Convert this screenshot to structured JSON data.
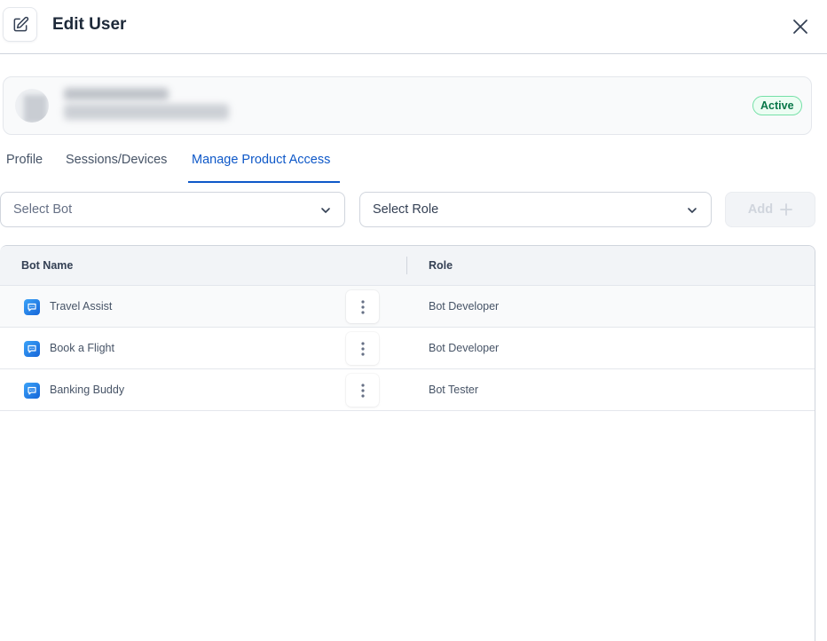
{
  "header": {
    "title": "Edit User",
    "edit_icon": "edit-pencil-icon",
    "close_icon": "close-icon"
  },
  "user": {
    "status": "Active"
  },
  "tabs": [
    {
      "label": "Profile"
    },
    {
      "label": "Sessions/Devices"
    },
    {
      "label": "Manage Product Access",
      "active": true
    }
  ],
  "controls": {
    "bot_select_placeholder": "Select Bot",
    "role_select_placeholder": "Select Role",
    "add_label": "Add",
    "add_icon": "plus-icon",
    "chevron_icon": "chevron-down-icon"
  },
  "table": {
    "columns": [
      "Bot Name",
      "Role"
    ],
    "rows": [
      {
        "bot": "Travel Assist",
        "role": "Bot Developer"
      },
      {
        "bot": "Book a Flight",
        "role": "Bot Developer"
      },
      {
        "bot": "Banking Buddy",
        "role": "Bot Tester"
      }
    ],
    "row_icon": "chat-bot-icon",
    "row_menu_icon": "more-vertical-icon"
  },
  "colors": {
    "accent": "#0e58c8",
    "active_badge_text": "#067647",
    "active_badge_bg": "#ecfdf3"
  }
}
